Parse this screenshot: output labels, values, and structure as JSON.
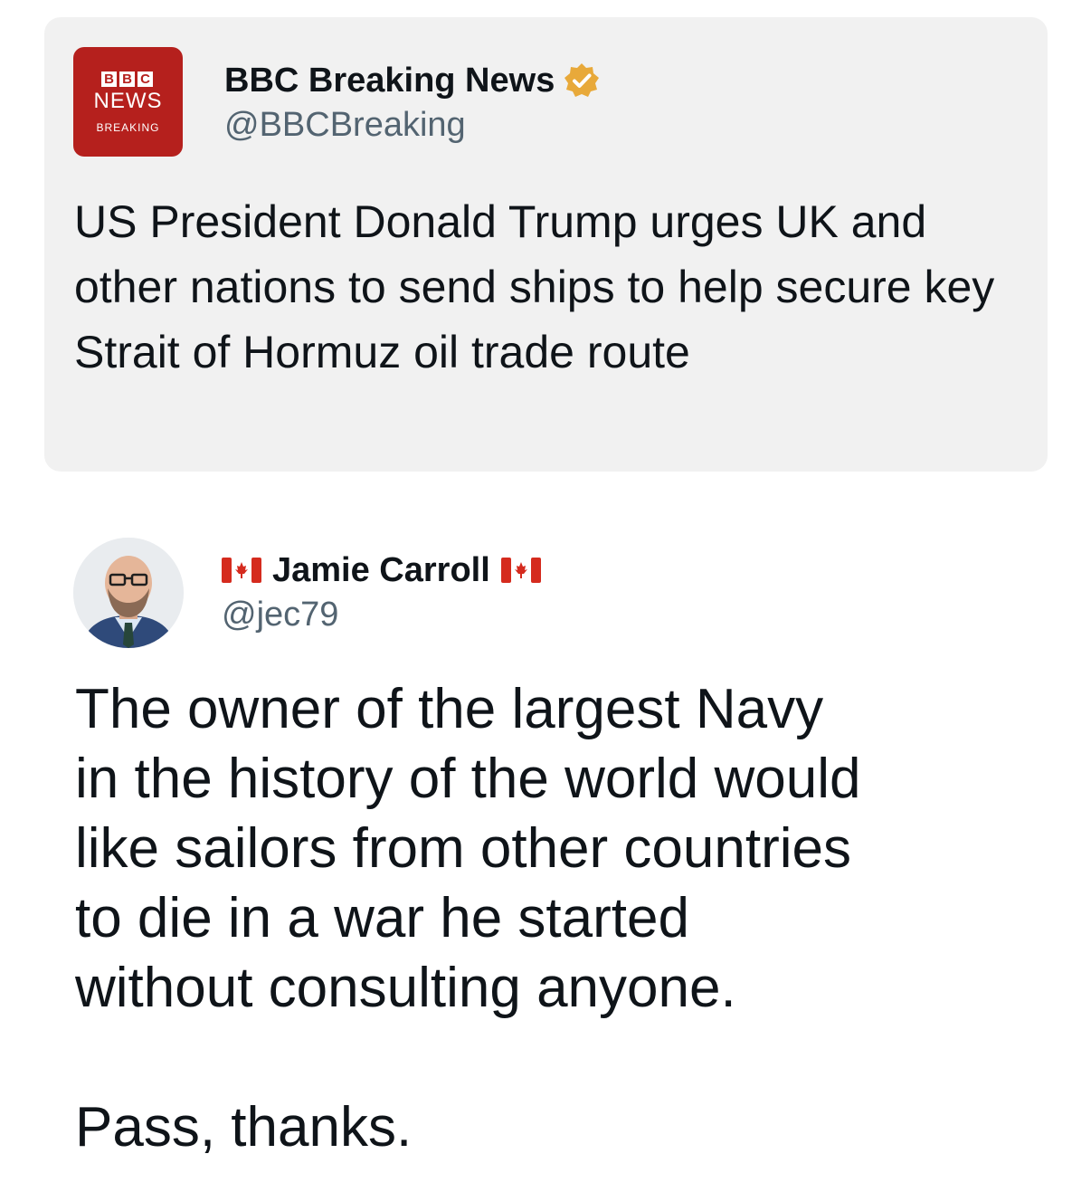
{
  "quoted_tweet": {
    "logo": {
      "blocks": [
        "B",
        "B",
        "C"
      ],
      "line1": "NEWS",
      "line2": "BREAKING",
      "color": "#b5201d"
    },
    "author_name": "BBC Breaking News",
    "verified_badge_color": "#e8a93a",
    "handle": "@BBCBreaking",
    "text": "US President Donald Trump urges UK and other nations to send ships to help secure key Strait of Hormuz oil trade route"
  },
  "tweet": {
    "author_name": "Jamie Carroll",
    "name_prefix_icon": "canada-flag-icon",
    "name_suffix_icon": "canada-flag-icon",
    "handle": "@jec79",
    "avatar_icon": "profile-photo",
    "text_lines": [
      "The owner of the largest Navy",
      "in the history of the world would",
      "like sailors from other countries",
      "to die in a war he started",
      "without consulting anyone."
    ],
    "closing_line": "Pass, thanks."
  },
  "colors": {
    "card_background": "#f1f1f1",
    "text_primary": "#0f1419",
    "text_secondary": "#536471",
    "flag_red": "#d52b1e"
  }
}
